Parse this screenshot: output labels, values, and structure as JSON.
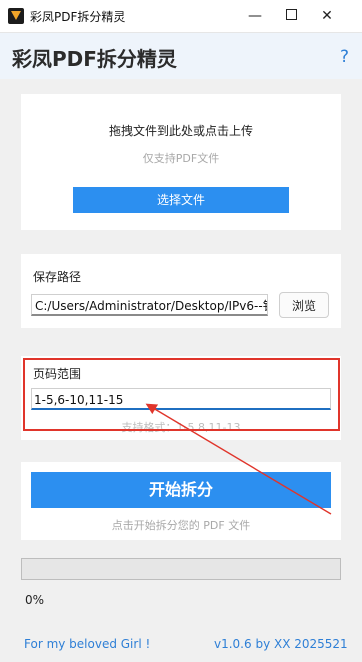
{
  "window": {
    "title": "彩凤PDF拆分精灵",
    "minimize": "—",
    "close": "✕"
  },
  "header": {
    "title": "彩凤PDF拆分精灵",
    "help": "?"
  },
  "upload": {
    "title": "拖拽文件到此处或点击上传",
    "hint": "仅支持PDF文件",
    "button": "选择文件"
  },
  "save": {
    "label": "保存路径",
    "path": "C:/Users/Administrator/Desktop/IPv6--钅",
    "browse": "浏览"
  },
  "range": {
    "label": "页码范围",
    "value": "1-5,6-10,11-15",
    "hint": "支持格式：1-5,8,11-13"
  },
  "action": {
    "start": "开始拆分",
    "hint": "点击开始拆分您的 PDF 文件"
  },
  "progress": {
    "value": 0,
    "text": "0%"
  },
  "footer": {
    "left": "For my beloved Girl !",
    "right": "v1.0.6 by XX 2025521"
  },
  "colors": {
    "accent": "#2c8ff0",
    "annotation": "#e0352b",
    "link": "#2e7fd6"
  }
}
